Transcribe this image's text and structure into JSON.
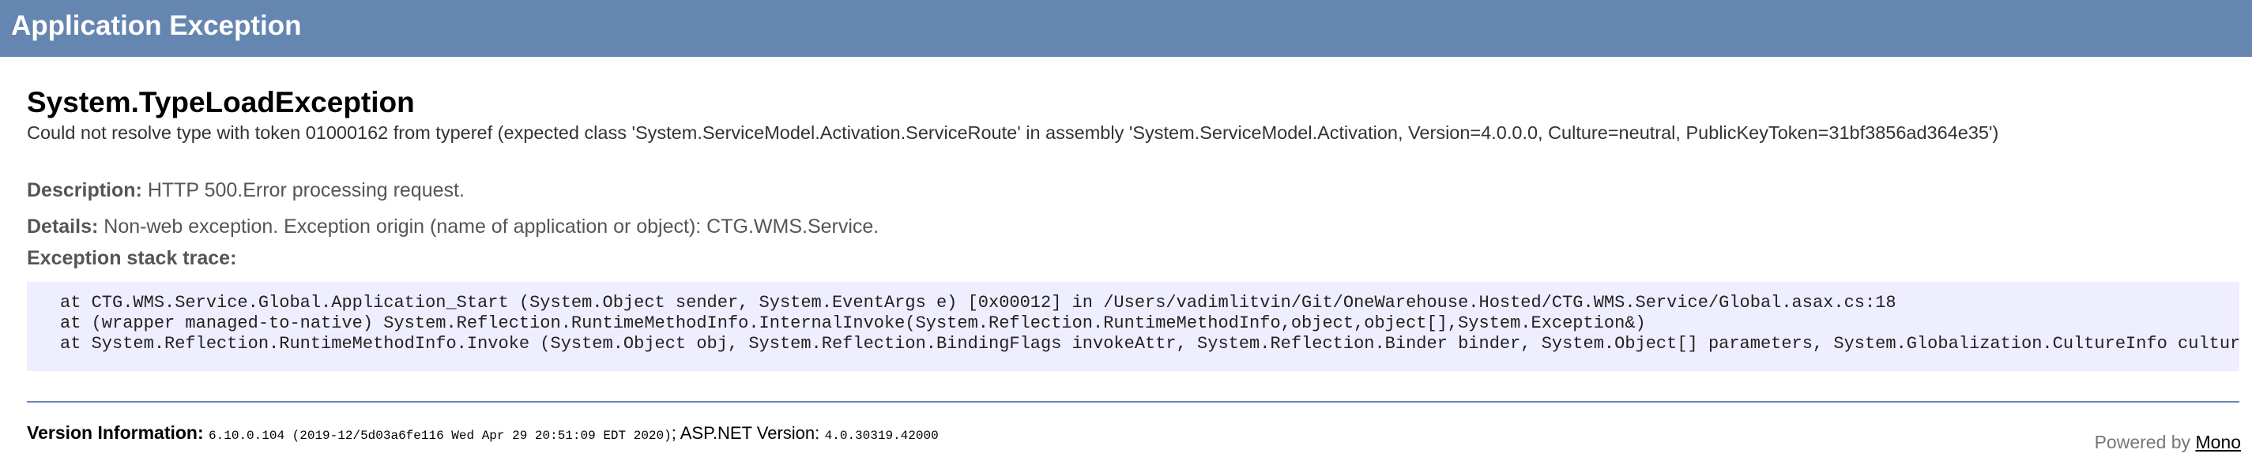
{
  "header": {
    "title": "Application Exception"
  },
  "exception": {
    "type": "System.TypeLoadException",
    "message": "Could not resolve type with token 01000162 from typeref (expected class 'System.ServiceModel.Activation.ServiceRoute' in assembly 'System.ServiceModel.Activation, Version=4.0.0.0, Culture=neutral, PublicKeyToken=31bf3856ad364e35')"
  },
  "description": {
    "label": "Description:",
    "value": "HTTP 500.Error processing request."
  },
  "details": {
    "label": "Details:",
    "value": "Non-web exception. Exception origin (name of application or object): CTG.WMS.Service."
  },
  "stack_trace": {
    "title": "Exception stack trace:",
    "lines": [
      "at CTG.WMS.Service.Global.Application_Start (System.Object sender, System.EventArgs e) [0x00012] in /Users/vadimlitvin/Git/OneWarehouse.Hosted/CTG.WMS.Service/Global.asax.cs:18",
      "at (wrapper managed-to-native) System.Reflection.RuntimeMethodInfo.InternalInvoke(System.Reflection.RuntimeMethodInfo,object,object[],System.Exception&)",
      "at System.Reflection.RuntimeMethodInfo.Invoke (System.Object obj, System.Reflection.BindingFlags invokeAttr, System.Reflection.Binder binder, System.Object[] parameters, System.Globalization.CultureInfo culture)"
    ]
  },
  "version_info": {
    "label": "Version Information:",
    "mono_version": "6.10.0.104 (2019-12/5d03a6fe116 Wed Apr 29 20:51:09 EDT 2020)",
    "aspnet_label": "; ASP.NET Version:",
    "aspnet_version": "4.0.30319.42000"
  },
  "footer": {
    "powered_by": "Powered by",
    "mono_link": "Mono"
  },
  "colors": {
    "header_bg": "#6586b0",
    "stack_bg": "#eeeeff"
  }
}
